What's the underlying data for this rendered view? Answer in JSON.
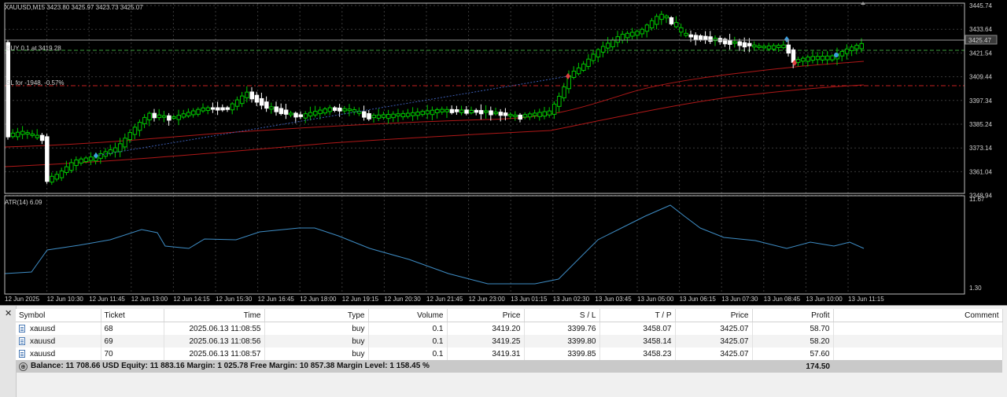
{
  "chart": {
    "header": "XAUUSD,M15  3423.80 3425.97 3423.73 3425.07",
    "buy_label": "BUY 0.1 at 3419.28",
    "sl_label": "SL for -1948, -0.57%",
    "atr_label": "ATR(14) 6.09",
    "price_axis": [
      "3445.74",
      "3433.64",
      "3421.54",
      "3409.44",
      "3397.34",
      "3385.24",
      "3373.14",
      "3361.04",
      "3348.94"
    ],
    "current_price": "3425.47",
    "atr_axis": [
      "11.67",
      "1.30"
    ],
    "time_axis": [
      "12 Jun 2025",
      "12 Jun 10:30",
      "12 Jun 11:45",
      "12 Jun 13:00",
      "12 Jun 14:15",
      "12 Jun 15:30",
      "12 Jun 16:45",
      "12 Jun 18:00",
      "12 Jun 19:15",
      "12 Jun 20:30",
      "12 Jun 21:45",
      "12 Jun 23:00",
      "13 Jun 01:15",
      "13 Jun 02:30",
      "13 Jun 03:45",
      "13 Jun 05:00",
      "13 Jun 06:15",
      "13 Jun 07:30",
      "13 Jun 08:45",
      "13 Jun 10:00",
      "13 Jun 11:15"
    ],
    "colors": {
      "bull": "#00c800",
      "bear": "#ffffff",
      "ma": "#b01818",
      "atr": "#3e8cc4",
      "grid": "#3a3a3a"
    }
  },
  "terminal": {
    "columns": [
      "Symbol",
      "Ticket",
      "Time",
      "Type",
      "Volume",
      "Price",
      "S / L",
      "T / P",
      "Price",
      "Profit",
      "Comment"
    ],
    "rows": [
      {
        "symbol": "xauusd",
        "ticket": "68",
        "time": "2025.06.13 11:08:55",
        "type": "buy",
        "volume": "0.1",
        "price": "3419.20",
        "sl": "3399.76",
        "tp": "3458.07",
        "cur_price": "3425.07",
        "profit": "58.70",
        "comment": ""
      },
      {
        "symbol": "xauusd",
        "ticket": "69",
        "time": "2025.06.13 11:08:56",
        "type": "buy",
        "volume": "0.1",
        "price": "3419.25",
        "sl": "3399.80",
        "tp": "3458.14",
        "cur_price": "3425.07",
        "profit": "58.20",
        "comment": ""
      },
      {
        "symbol": "xauusd",
        "ticket": "70",
        "time": "2025.06.13 11:08:57",
        "type": "buy",
        "volume": "0.1",
        "price": "3419.31",
        "sl": "3399.85",
        "tp": "3458.23",
        "cur_price": "3425.07",
        "profit": "57.60",
        "comment": ""
      }
    ],
    "summary_text": "Balance: 11 708.66 USD  Equity: 11 883.16  Margin: 1 025.78  Free Margin: 10 857.38  Margin Level: 1 158.45 %",
    "summary_profit": "174.50"
  }
}
